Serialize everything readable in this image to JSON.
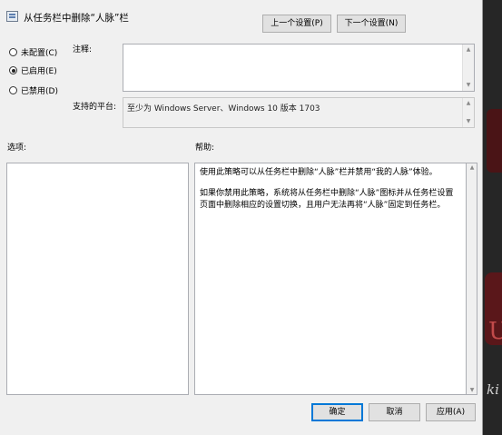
{
  "window": {
    "title": "从任务栏中删除“人脉”栏"
  },
  "nav": {
    "prev_label": "上一个设置(P)",
    "next_label": "下一个设置(N)"
  },
  "state": {
    "options": [
      {
        "label": "未配置(C)",
        "selected": false
      },
      {
        "label": "已启用(E)",
        "selected": true
      },
      {
        "label": "已禁用(D)",
        "selected": false
      }
    ]
  },
  "comment": {
    "label": "注释:",
    "value": ""
  },
  "platform": {
    "label": "支持的平台:",
    "value": "至少为 Windows Server、Windows 10 版本 1703"
  },
  "options_section": {
    "label": "选项:"
  },
  "help": {
    "label": "帮助:",
    "paragraphs": [
      "使用此策略可以从任务栏中删除“人脉”栏并禁用“我的人脉”体验。",
      "如果你禁用此策略，系统将从任务栏中删除“人脉”图标并从任务栏设置页面中删除相应的设置切换，且用户无法再将“人脉”固定到任务栏。"
    ]
  },
  "buttons": {
    "ok": "确定",
    "cancel": "取消",
    "apply": "应用(A)"
  },
  "desktop": {
    "glyph": "U",
    "glyph2": "ki"
  }
}
